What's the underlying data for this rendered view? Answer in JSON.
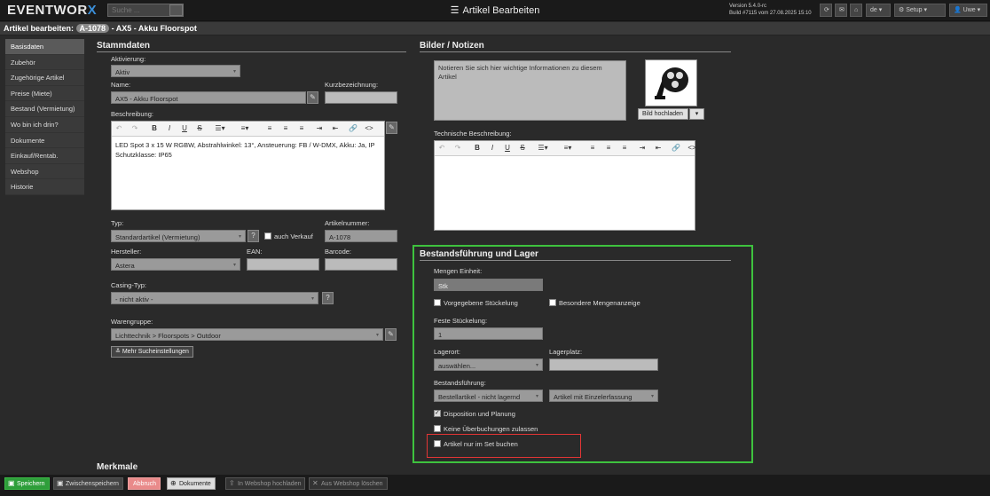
{
  "app": {
    "logo_text": "EVENTWOR",
    "logo_x": "X",
    "title": "Artikel Bearbeiten",
    "version": "Version 5.4.0-rc",
    "build": "Build #7115 vom 27.08.2025 15:10"
  },
  "search": {
    "placeholder": "Suche ..."
  },
  "topbar": {
    "lang": "de",
    "setup_label": "Setup",
    "user_label": "Uwe"
  },
  "subhead": {
    "prefix": "Artikel bearbeiten:",
    "article_id": "A-1078",
    "article_name": "- AX5 - Akku Floorspot"
  },
  "sidebar": {
    "items": [
      {
        "label": "Basisdaten"
      },
      {
        "label": "Zubehör"
      },
      {
        "label": "Zugehörige Artikel"
      },
      {
        "label": "Preise (Miete)"
      },
      {
        "label": "Bestand (Vermietung)"
      },
      {
        "label": "Wo bin ich drin?"
      },
      {
        "label": "Dokumente"
      },
      {
        "label": "Einkauf/Rentab."
      },
      {
        "label": "Webshop"
      },
      {
        "label": "Historie"
      }
    ]
  },
  "stammdaten": {
    "title": "Stammdaten",
    "aktivierung_label": "Aktivierung:",
    "aktivierung_value": "Aktiv",
    "name_label": "Name:",
    "name_value": "AX5 - Akku Floorspot",
    "kurz_label": "Kurzbezeichnung:",
    "kurz_value": "",
    "beschreibung_label": "Beschreibung:",
    "beschreibung_line1": "LED Spot 3 x 15 W RGBW, Abstrahlwinkel: 13°, Ansteuerung: FB / W-DMX, Akku: Ja, IP",
    "beschreibung_line2": "Schutzklasse: IP65",
    "typ_label": "Typ:",
    "typ_value": "Standardartikel (Vermietung)",
    "help_q": "?",
    "auch_verkauf": "auch Verkauf",
    "artnr_label": "Artikelnummer:",
    "artnr_value": "A-1078",
    "hersteller_label": "Hersteller:",
    "hersteller_value": "Astera",
    "ean_label": "EAN:",
    "ean_value": "",
    "barcode_label": "Barcode:",
    "barcode_value": "",
    "casing_label": "Casing-Typ:",
    "casing_value": "- nicht aktiv -",
    "warengruppe_label": "Warengruppe:",
    "warengruppe_value": "Lichttechnik  >  Floorspots  >  Outdoor",
    "mehr_label": "Mehr Sucheinstellungen"
  },
  "bilder": {
    "title": "Bilder / Notizen",
    "notes_placeholder": "Notieren Sie sich hier wichtige Informationen zu diesem Artikel",
    "upload_label": "Bild hochladen",
    "tech_label": "Technische Beschreibung:"
  },
  "lager": {
    "title": "Bestandsführung und Lager",
    "mengen_label": "Mengen Einheit:",
    "mengen_value": "Stk",
    "vorgegeben": "Vorgegebene Stückelung",
    "besondere": "Besondere Mengenanzeige",
    "feste_label": "Feste Stückelung:",
    "feste_value": "1",
    "lagerort_label": "Lagerort:",
    "lagerort_value": "auswählen...",
    "lagerplatz_label": "Lagerplatz:",
    "lagerplatz_value": "",
    "bestand_label": "Bestandsführung:",
    "bestand_value": "Bestellartikel - nicht lagernd",
    "erfassung_value": "Artikel mit Einzelerfassung",
    "disposition": "Disposition und Planung",
    "keine_ueber": "Keine Überbuchungen zulassen",
    "nur_set": "Artikel nur im Set buchen"
  },
  "merkmale": {
    "title": "Merkmale"
  },
  "bottom": {
    "speichern": "Speichern",
    "zwischen": "Zwischenspeichern",
    "abbruch": "Abbruch",
    "dokumente": "Dokumente",
    "webshop_up": "In Webshop hochladen",
    "webshop_del": "Aus Webshop löschen"
  }
}
